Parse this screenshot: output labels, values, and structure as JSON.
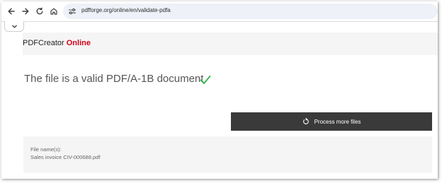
{
  "browser": {
    "url": "pdfforge.org/online/en/validate-pdfa",
    "nav": {
      "back_icon": "arrow-left-icon",
      "forward_icon": "arrow-right-icon",
      "reload_icon": "reload-icon",
      "home_icon": "home-icon",
      "site_info_icon": "tune-icon",
      "tab_toggle_icon": "chevron-down-icon"
    }
  },
  "header": {
    "brand_prefix": "PDFCreator",
    "brand_suffix": "Online",
    "brand_suffix_color": "#d0021b"
  },
  "result": {
    "message": "The file is a valid PDF/A-1B document",
    "status_icon": "checkmark-icon",
    "status_color": "#2db34a"
  },
  "actions": {
    "process_more_label": "Process more files",
    "process_more_icon": "refresh-icon"
  },
  "file_info": {
    "label": "File name(s):",
    "name": "Sales invoice CIV-000688.pdf"
  }
}
